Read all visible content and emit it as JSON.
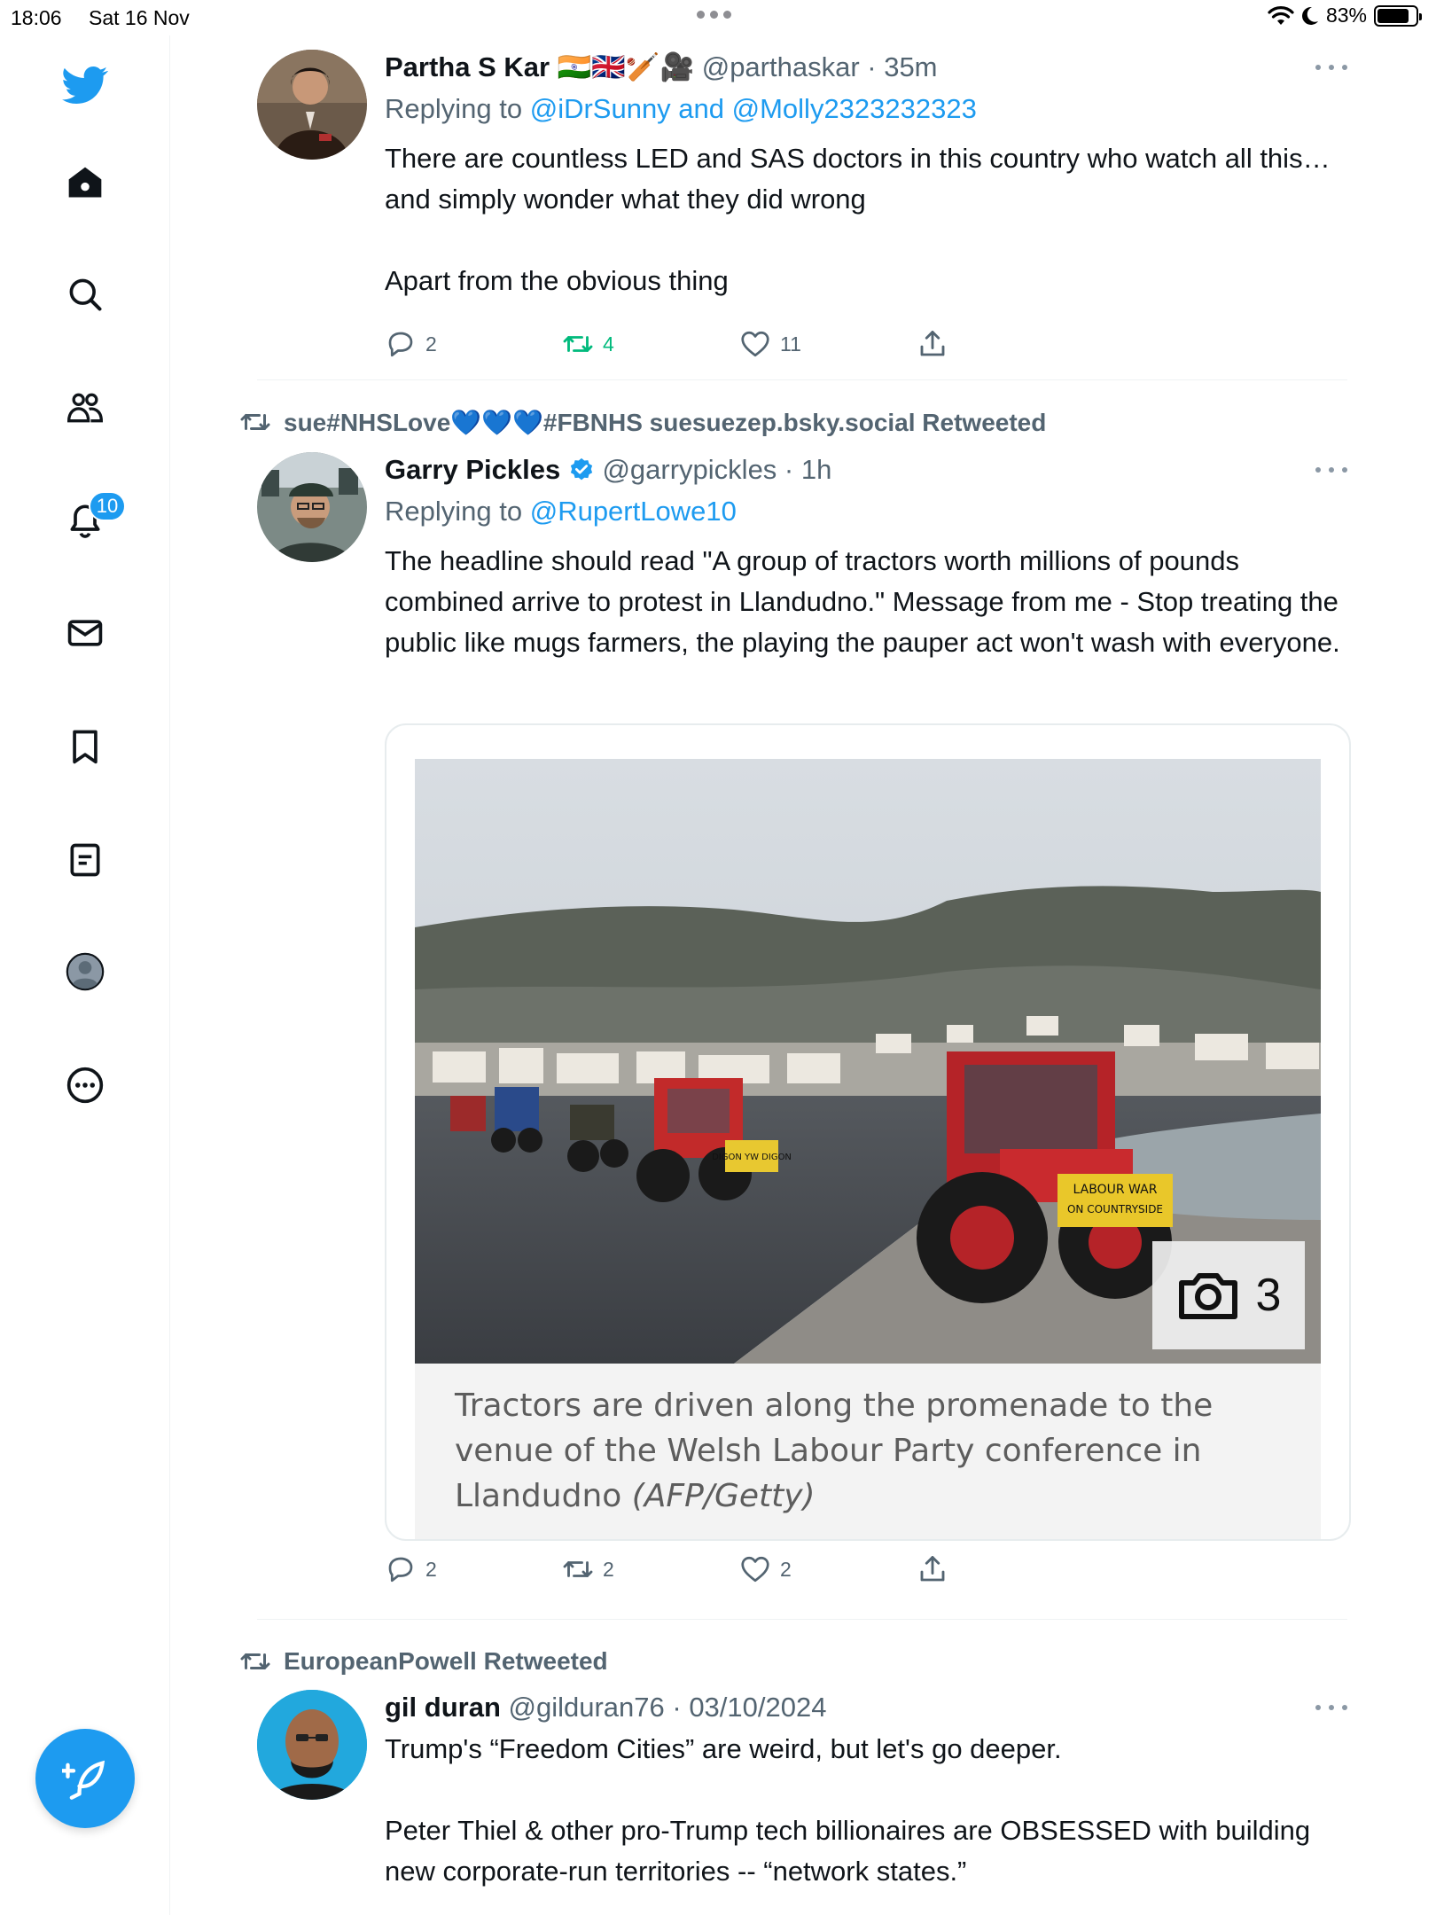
{
  "status_bar": {
    "time": "18:06",
    "date": "Sat 16 Nov",
    "battery": "83%",
    "battery_level": 0.83
  },
  "sidebar": {
    "items": [
      {
        "icon": "twitter-bird-icon"
      },
      {
        "icon": "home-icon"
      },
      {
        "icon": "search-icon"
      },
      {
        "icon": "communities-icon"
      },
      {
        "icon": "bell-icon",
        "badge": "10"
      },
      {
        "icon": "mail-icon"
      },
      {
        "icon": "bookmark-icon"
      },
      {
        "icon": "lists-icon"
      },
      {
        "icon": "profile-icon"
      },
      {
        "icon": "more-circle-icon"
      }
    ],
    "compose_icon": "compose-icon",
    "accent": "#1d9bf0"
  },
  "tweets": [
    {
      "name": "Partha S Kar 🇮🇳🇬🇧🏏🎥",
      "meta": "@parthaskar · 35m",
      "replying_prefix": "Replying to ",
      "replying_to": "@iDrSunny and @Molly2323232323",
      "text": "There are countless LED and SAS doctors in this country who watch all this…and simply wonder what they did wrong\n\nApart from the obvious thing",
      "replies": "2",
      "retweets": "4",
      "likes": "11"
    },
    {
      "retweeted_by": "sue#NHSLove💙💙💙#FBNHS suesuezep.bsky.social Retweeted",
      "name": "Garry Pickles",
      "verified": true,
      "meta": "@garrypickles · 1h",
      "replying_prefix": "Replying to ",
      "replying_to": "@RupertLowe10",
      "text": "The headline should read \"A group of tractors worth millions of pounds combined arrive to protest in Llandudno.\" Message from me - Stop treating the public like mugs farmers, the playing the pauper act won't wash with everyone.",
      "media": {
        "photo_count": "3",
        "caption": "Tractors are driven along the promenade to the venue of the Welsh Labour Party conference in Llandudno",
        "credit": "(AFP/Getty)",
        "sign_1": "DIGON YW DIGON",
        "sign_2_line1": "LABOUR WAR",
        "sign_2_line2": "ON COUNTRYSIDE"
      },
      "replies": "2",
      "retweets": "2",
      "likes": "2"
    },
    {
      "retweeted_by": "EuropeanPowell Retweeted",
      "name": "gil duran",
      "meta": "@gilduran76 · 03/10/2024",
      "text": "Trump's “Freedom Cities” are weird, but let's go deeper.\n\nPeter Thiel & other pro-Trump tech billionaires are OBSESSED with building new corporate-run territories -- “network states.”"
    }
  ]
}
